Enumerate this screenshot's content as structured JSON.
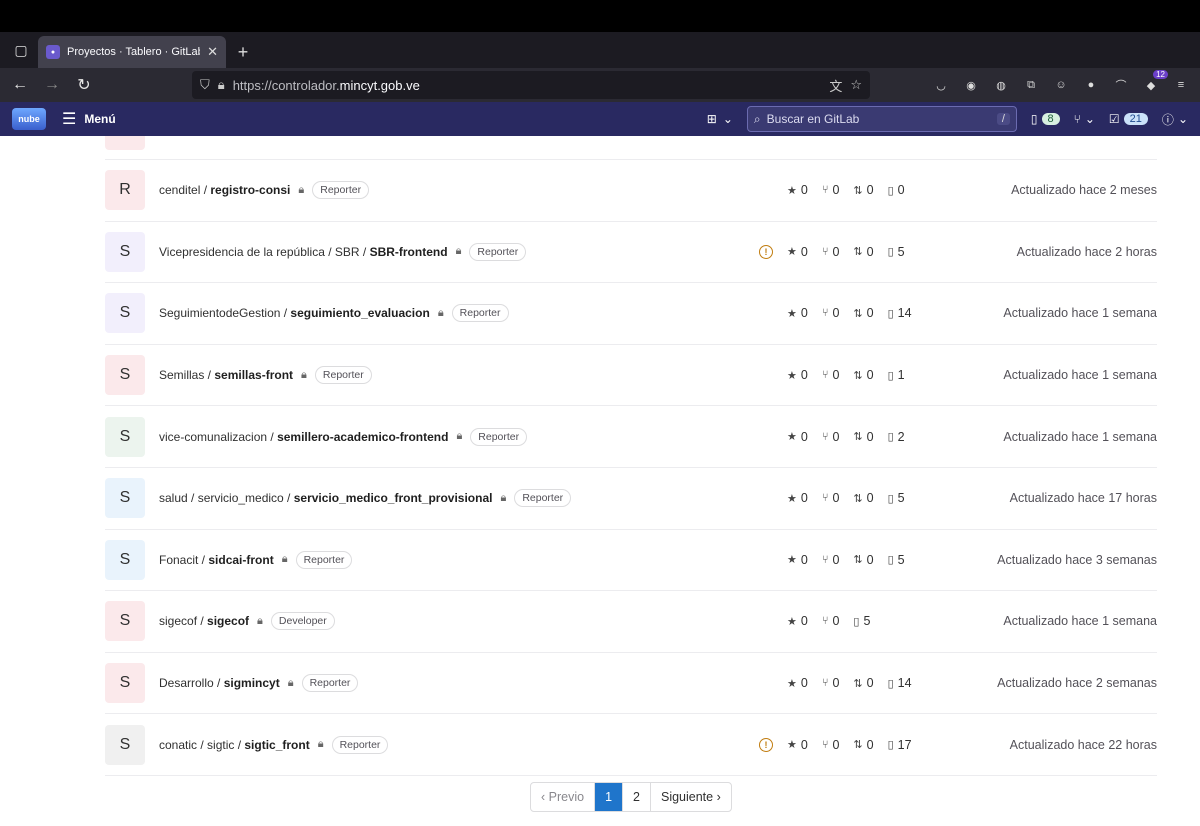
{
  "browser": {
    "tab_title": "Proyectos · Tablero · GitLab",
    "url_prefix": "https://controlador.",
    "url_domain": "mincyt.gob.ve",
    "extension_badge": "12"
  },
  "header": {
    "logo_text": "nube",
    "menu_label": "Menú",
    "search_placeholder": "Buscar en GitLab",
    "search_shortcut": "/",
    "issues_count": "8",
    "todos_count": "21"
  },
  "projects": [
    {
      "avatar": "R",
      "namespace": "cenditel / ",
      "name": "registro-consi",
      "role": "Reporter",
      "warning": false,
      "stars": "0",
      "forks": "0",
      "mrs": "0",
      "issues": "0",
      "updated": "Actualizado hace 2 meses",
      "color": "pink"
    },
    {
      "avatar": "S",
      "namespace": "Vicepresidencia de la república / SBR / ",
      "name": "SBR-frontend",
      "role": "Reporter",
      "warning": true,
      "stars": "0",
      "forks": "0",
      "mrs": "0",
      "issues": "5",
      "updated": "Actualizado hace 2 horas",
      "color": "purple"
    },
    {
      "avatar": "S",
      "namespace": "SeguimientodeGestion / ",
      "name": "seguimiento_evaluacion",
      "role": "Reporter",
      "warning": false,
      "stars": "0",
      "forks": "0",
      "mrs": "0",
      "issues": "14",
      "updated": "Actualizado hace 1 semana",
      "color": "purple"
    },
    {
      "avatar": "S",
      "namespace": "Semillas / ",
      "name": "semillas-front",
      "role": "Reporter",
      "warning": false,
      "stars": "0",
      "forks": "0",
      "mrs": "0",
      "issues": "1",
      "updated": "Actualizado hace 1 semana",
      "color": "pink"
    },
    {
      "avatar": "S",
      "namespace": "vice-comunalizacion / ",
      "name": "semillero-academico-frontend",
      "role": "Reporter",
      "warning": false,
      "stars": "0",
      "forks": "0",
      "mrs": "0",
      "issues": "2",
      "updated": "Actualizado hace 1 semana",
      "color": "green"
    },
    {
      "avatar": "S",
      "namespace": "salud / servicio_medico / ",
      "name": "servicio_medico_front_provisional",
      "role": "Reporter",
      "warning": false,
      "stars": "0",
      "forks": "0",
      "mrs": "0",
      "issues": "5",
      "updated": "Actualizado hace 17 horas",
      "color": "blue"
    },
    {
      "avatar": "S",
      "namespace": "Fonacit / ",
      "name": "sidcai-front",
      "role": "Reporter",
      "warning": false,
      "stars": "0",
      "forks": "0",
      "mrs": "0",
      "issues": "5",
      "updated": "Actualizado hace 3 semanas",
      "color": "blue"
    },
    {
      "avatar": "S",
      "namespace": "sigecof / ",
      "name": "sigecof",
      "role": "Developer",
      "warning": false,
      "stars": "0",
      "forks": "0",
      "mrs": null,
      "issues": "5",
      "updated": "Actualizado hace 1 semana",
      "color": "pink"
    },
    {
      "avatar": "S",
      "namespace": "Desarrollo / ",
      "name": "sigmincyt",
      "role": "Reporter",
      "warning": false,
      "stars": "0",
      "forks": "0",
      "mrs": "0",
      "issues": "14",
      "updated": "Actualizado hace 2 semanas",
      "color": "pink"
    },
    {
      "avatar": "S",
      "namespace": "conatic / sigtic / ",
      "name": "sigtic_front",
      "role": "Reporter",
      "warning": true,
      "stars": "0",
      "forks": "0",
      "mrs": "0",
      "issues": "17",
      "updated": "Actualizado hace 22 horas",
      "color": "gray"
    }
  ],
  "pagination": {
    "prev": "‹ Previo",
    "pages": [
      "1",
      "2"
    ],
    "active": "1",
    "next": "Siguiente ›"
  }
}
